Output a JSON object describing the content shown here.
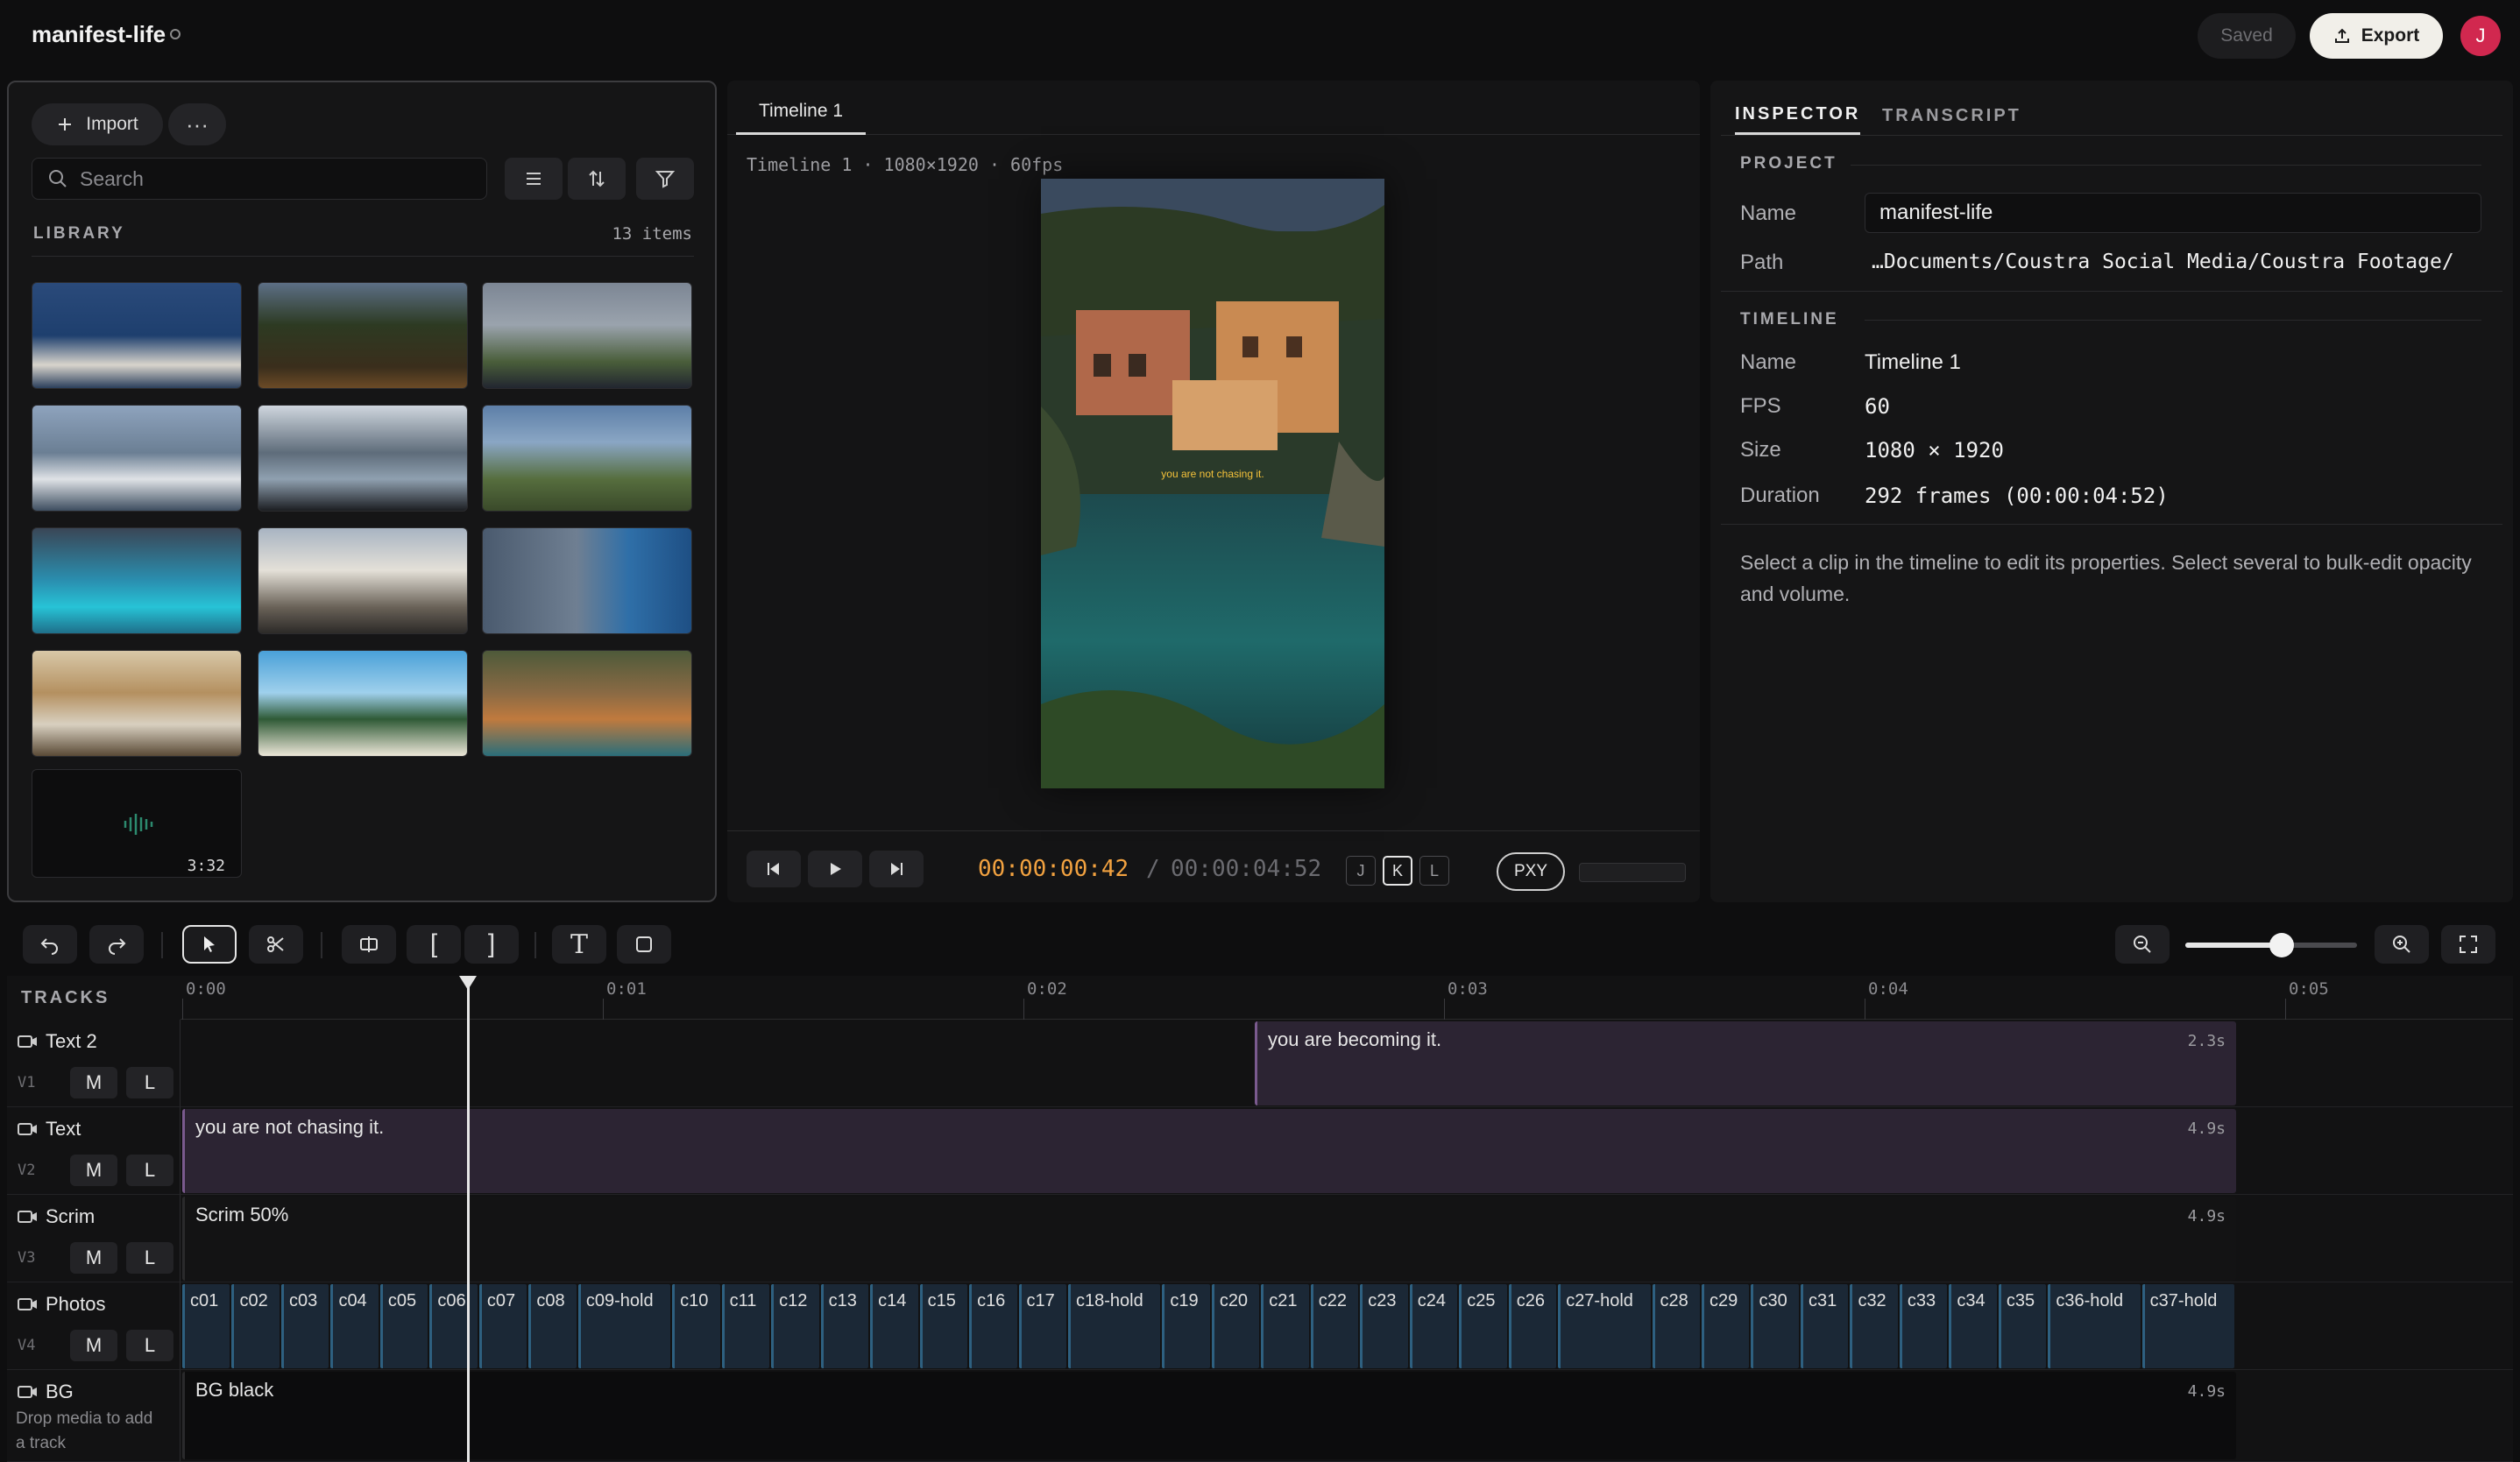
{
  "app": {
    "title": "manifest-life",
    "saved_label": "Saved",
    "export_label": "Export",
    "avatar_initial": "J"
  },
  "library": {
    "import_label": "Import",
    "more_label": "···",
    "search_placeholder": "Search",
    "label": "LIBRARY",
    "count": "13 items",
    "audio_duration": "3:32"
  },
  "preview": {
    "tab": "Timeline 1",
    "meta": "Timeline 1 · 1080×1920 · 60fps",
    "overlay_text": "you are not chasing it.",
    "timecode_current": "00:00:00:42",
    "timecode_sep": "/",
    "timecode_total": "00:00:04:52",
    "keys": [
      "J",
      "K",
      "L"
    ],
    "proxy_label": "PXY"
  },
  "inspector": {
    "tabs": [
      "INSPECTOR",
      "TRANSCRIPT"
    ],
    "project_title": "PROJECT",
    "project_name_label": "Name",
    "project_name_value": "manifest-life",
    "project_path_label": "Path",
    "project_path_value": "…Documents/Coustra Social Media/Coustra Footage/",
    "timeline_title": "TIMELINE",
    "timeline_name_label": "Name",
    "timeline_name_value": "Timeline 1",
    "fps_label": "FPS",
    "fps_value": "60",
    "size_label": "Size",
    "size_value": "1080 × 1920",
    "duration_label": "Duration",
    "duration_value": "292 frames (00:00:04:52)",
    "help_text": "Select a clip in the timeline to edit its properties. Select several to bulk-edit opacity and volume."
  },
  "toolbar": {
    "zoom_level": 0.56
  },
  "timeline": {
    "tracks_label": "TRACKS",
    "ruler": [
      "0:00",
      "0:01",
      "0:02",
      "0:03",
      "0:04",
      "0:05"
    ],
    "tracks": [
      {
        "name": "Text 2",
        "id": "V1",
        "mute": "M",
        "lock": "L",
        "clip": "you are becoming it.",
        "dur": "2.3s"
      },
      {
        "name": "Text",
        "id": "V2",
        "mute": "M",
        "lock": "L",
        "clip": "you are not chasing it.",
        "dur": "4.9s"
      },
      {
        "name": "Scrim",
        "id": "V3",
        "mute": "M",
        "lock": "L",
        "clip": "Scrim 50%",
        "dur": "4.9s"
      },
      {
        "name": "Photos",
        "id": "V4",
        "mute": "M",
        "lock": "L"
      },
      {
        "name": "BG",
        "clip": "BG black",
        "dur": "4.9s"
      }
    ],
    "photo_clips": [
      "c01",
      "c02",
      "c03",
      "c04",
      "c05",
      "c06",
      "c07",
      "c08",
      "c09-hold",
      "c10",
      "c11",
      "c12",
      "c13",
      "c14",
      "c15",
      "c16",
      "c17",
      "c18-hold",
      "c19",
      "c20",
      "c21",
      "c22",
      "c23",
      "c24",
      "c25",
      "c26",
      "c27-hold",
      "c28",
      "c29",
      "c30",
      "c31",
      "c32",
      "c33",
      "c34",
      "c35",
      "c36-hold",
      "c37-hold"
    ],
    "drop_hint": "Drop media to add a track"
  }
}
